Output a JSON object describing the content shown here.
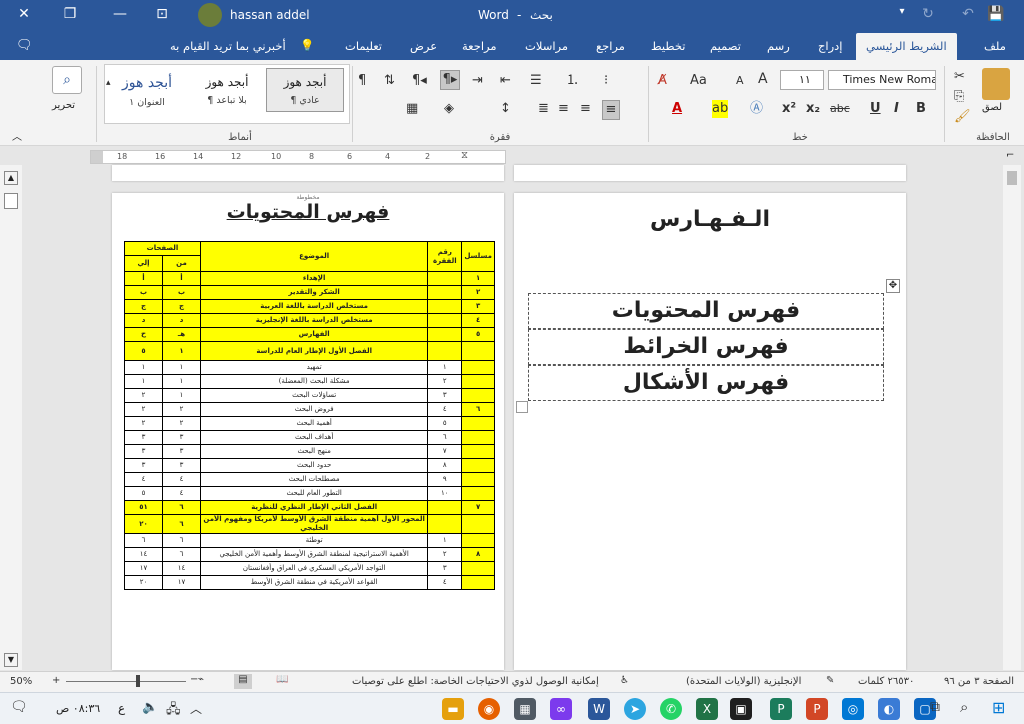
{
  "titlebar": {
    "app_name": "Word",
    "separator": "-",
    "search_label": "بحث",
    "user_name": "hassan addel"
  },
  "tabs": [
    {
      "label": "ملف"
    },
    {
      "label": "الشريط الرئيسي"
    },
    {
      "label": "إدراج"
    },
    {
      "label": "رسم"
    },
    {
      "label": "تصميم"
    },
    {
      "label": "تخطيط"
    },
    {
      "label": "مراجع"
    },
    {
      "label": "مراسلات"
    },
    {
      "label": "مراجعة"
    },
    {
      "label": "عرض"
    },
    {
      "label": "تعليمات"
    },
    {
      "label": "أخبرني بما تريد القيام به"
    }
  ],
  "ribbon": {
    "clipboard": {
      "paste_label": "لصق",
      "group_label": "الحافظة"
    },
    "font": {
      "font_name": "Times New Roman",
      "font_size": "١١",
      "group_label": "خط",
      "size_up": "A",
      "size_down": "A",
      "case_label": "Aa",
      "bold": "B",
      "italic": "I",
      "underline": "U",
      "strike": "abc",
      "subscript": "x₂",
      "superscript": "x²"
    },
    "paragraph": {
      "group_label": "فقرة"
    },
    "styles": {
      "group_label": "أنماط",
      "items": [
        {
          "preview": "أبجد هوز",
          "name": "¶ عادي"
        },
        {
          "preview": "أبجد هوز",
          "name": "¶ بلا تباعد"
        },
        {
          "preview": "أبجد هوز",
          "name": "العنوان ١"
        }
      ]
    },
    "editing": {
      "label": "تحرير"
    }
  },
  "ruler": {
    "ticks": [
      "18",
      "16",
      "14",
      "12",
      "10",
      "8",
      "6",
      "4",
      "2"
    ]
  },
  "left_page": {
    "header_text": "مخطوطة",
    "title": "فهرس المحتويات",
    "table_headers": {
      "serial": "مسلسل",
      "para_no": "رقم الفقرة",
      "topic": "الموضوع",
      "pages": "الصفحات",
      "from": "من",
      "to": "إلي"
    },
    "rows": [
      {
        "serial": "١",
        "para": "",
        "topic": "الإهداء",
        "from": "أ",
        "to": "أ",
        "type": "y"
      },
      {
        "serial": "٢",
        "para": "",
        "topic": "الشكر والتقدير",
        "from": "ب",
        "to": "ب",
        "type": "y"
      },
      {
        "serial": "٣",
        "para": "",
        "topic": "مستخلص الدراسة باللغة العربية",
        "from": "ج",
        "to": "ج",
        "type": "y"
      },
      {
        "serial": "٤",
        "para": "",
        "topic": "مستخلص الدراسة باللغة الإنجليزية",
        "from": "د",
        "to": "د",
        "type": "y"
      },
      {
        "serial": "٥",
        "para": "",
        "topic": "الفهارس",
        "from": "هـ",
        "to": "ح",
        "type": "y"
      },
      {
        "serial": "",
        "para": "",
        "topic": "الفصل الأول الإطار العام للدراسة",
        "from": "١",
        "to": "٥",
        "type": "y"
      },
      {
        "serial": "",
        "para": "١",
        "topic": "تمهيد",
        "from": "١",
        "to": "١",
        "type": "n"
      },
      {
        "serial": "",
        "para": "٢",
        "topic": "مشكلة البحث (المعضلة)",
        "from": "١",
        "to": "١",
        "type": "n"
      },
      {
        "serial": "",
        "para": "٣",
        "topic": "تساؤلات البحث",
        "from": "١",
        "to": "٢",
        "type": "n"
      },
      {
        "serial": "٦",
        "para": "٤",
        "topic": "فروض البحث",
        "from": "٢",
        "to": "٢",
        "type": "n"
      },
      {
        "serial": "",
        "para": "٥",
        "topic": "أهمية البحث",
        "from": "٢",
        "to": "٢",
        "type": "n"
      },
      {
        "serial": "",
        "para": "٦",
        "topic": "أهداف البحث",
        "from": "٣",
        "to": "٣",
        "type": "n"
      },
      {
        "serial": "",
        "para": "٧",
        "topic": "منهج البحث",
        "from": "٣",
        "to": "٣",
        "type": "n"
      },
      {
        "serial": "",
        "para": "٨",
        "topic": "حدود البحث",
        "from": "٣",
        "to": "٣",
        "type": "n"
      },
      {
        "serial": "",
        "para": "٩",
        "topic": "مصطلحات البحث",
        "from": "٤",
        "to": "٤",
        "type": "n"
      },
      {
        "serial": "",
        "para": "١٠",
        "topic": "التطور العام للبحث",
        "from": "٤",
        "to": "٥",
        "type": "n"
      },
      {
        "serial": "٧",
        "para": "",
        "topic": "الفصل الثاني الإطار النظري للنظرية",
        "from": "٦",
        "to": "٥١",
        "type": "y"
      },
      {
        "serial": "",
        "para": "",
        "topic": "المحور الأول أهمية منطقة الشرق الأوسط لأمريكا ومفهوم الأمن الخليجي",
        "from": "٦",
        "to": "٢٠",
        "type": "y"
      },
      {
        "serial": "",
        "para": "١",
        "topic": "توطئة",
        "from": "٦",
        "to": "٦",
        "type": "n"
      },
      {
        "serial": "٨",
        "para": "٢",
        "topic": "الأهمية الاستراتيجية لمنطقة الشرق الأوسط وأهمية الأمن الخليجي",
        "from": "٦",
        "to": "١٤",
        "type": "n"
      },
      {
        "serial": "",
        "para": "٣",
        "topic": "التواجد الأمريكي العسكري في العراق وأفغانستان",
        "from": "١٤",
        "to": "١٧",
        "type": "n"
      },
      {
        "serial": "",
        "para": "٤",
        "topic": "القواعد الأمريكية في منطقة الشرق الأوسط",
        "from": "١٧",
        "to": "٢٠",
        "type": "n"
      }
    ]
  },
  "right_page": {
    "title": "الـفـهـارس",
    "items": [
      "فهرس المحتويات",
      "فهرس الخرائط",
      "فهرس الأشكال"
    ]
  },
  "statusbar": {
    "page": "الصفحة ٣ من ٩٦",
    "words": "٢٦٥٣٠ كلمات",
    "language": "الإنجليزية (الولايات المتحدة)",
    "accessibility": "إمكانية الوصول لذوي الاحتياجات الخاصة: اطلع على توصيات",
    "zoom": "50%"
  },
  "taskbar": {
    "time": "٠٨:٣٦ ص",
    "lang": "ع"
  }
}
